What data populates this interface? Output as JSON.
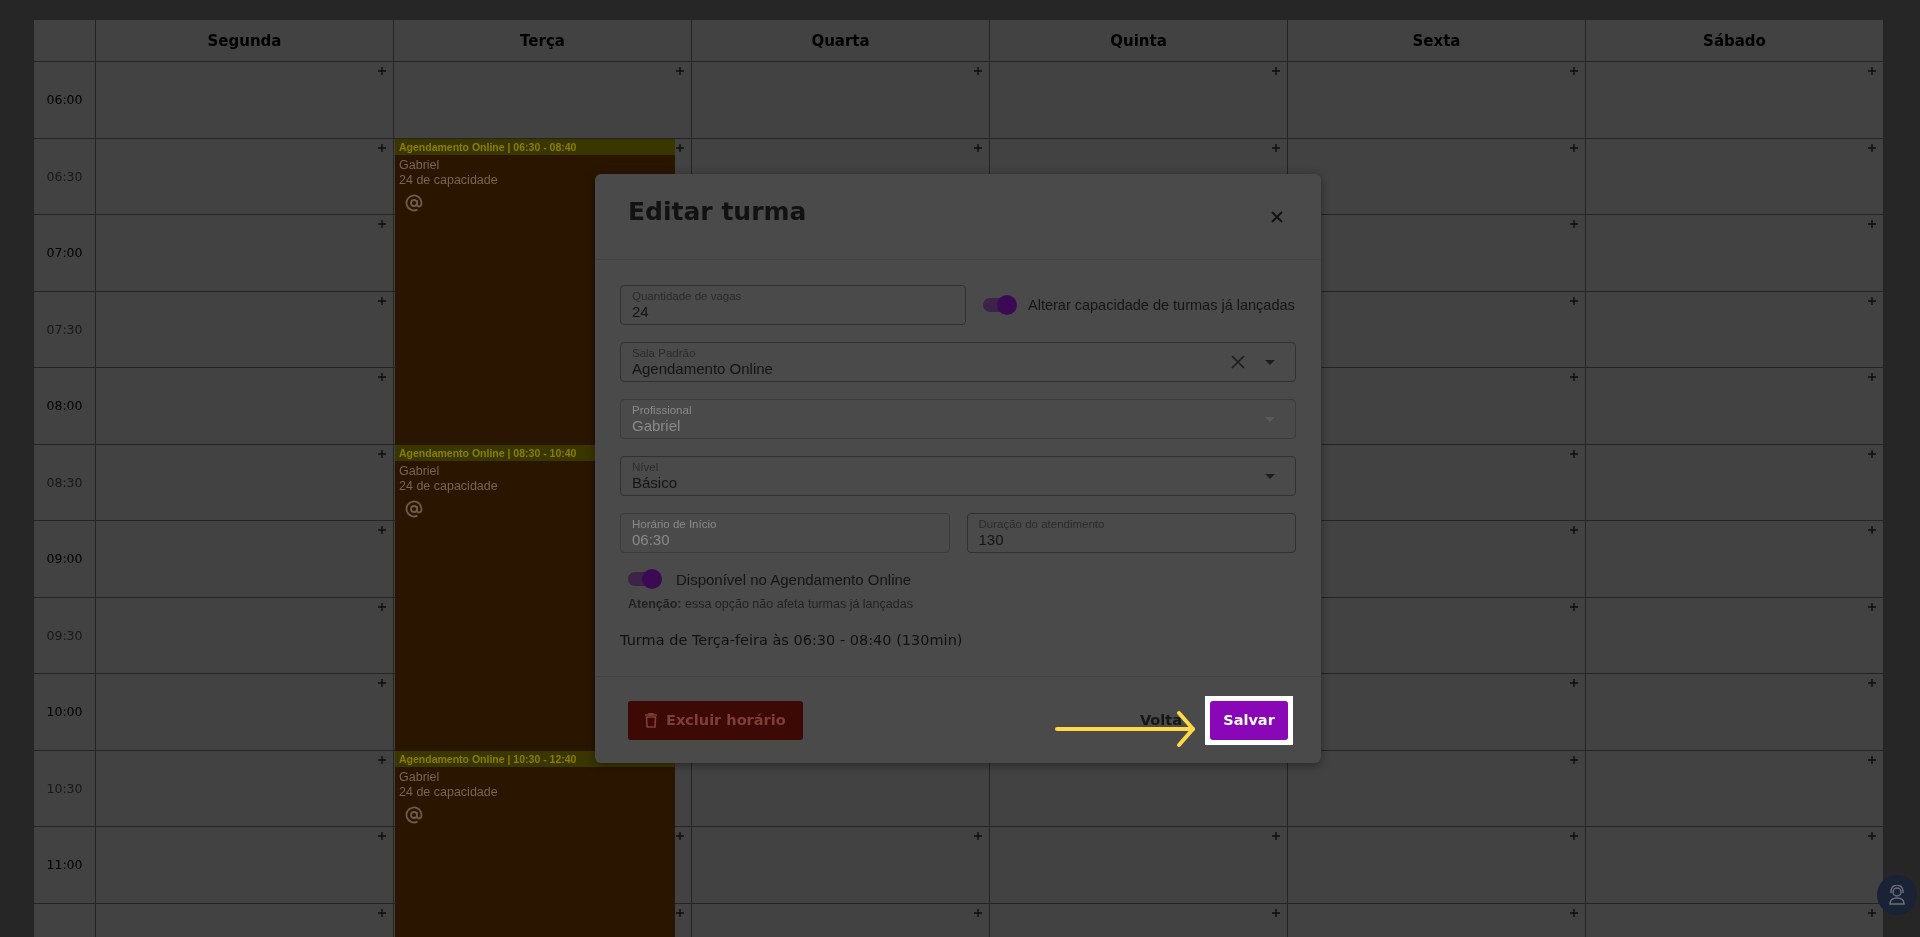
{
  "calendar": {
    "days": [
      {
        "label": "Segunda"
      },
      {
        "label": "Terça",
        "events": [
          {
            "title": "Agendamento Online | 06:30 - 08:40",
            "professional": "Gabriel",
            "capacity": "24 de capacidade",
            "online": true
          },
          {
            "title": "Agendamento Online | 08:30 - 10:40",
            "professional": "Gabriel",
            "capacity": "24 de capacidade",
            "online": true
          },
          {
            "title": "Agendamento Online | 10:30 - 12:40",
            "professional": "Gabriel",
            "capacity": "24 de capacidade",
            "online": true
          }
        ]
      },
      {
        "label": "Quarta"
      },
      {
        "label": "Quinta"
      },
      {
        "label": "Sexta"
      },
      {
        "label": "Sábado"
      }
    ],
    "times": [
      {
        "label": "06:00",
        "minor": false
      },
      {
        "label": "06:30",
        "minor": true
      },
      {
        "label": "07:00",
        "minor": false
      },
      {
        "label": "07:30",
        "minor": true
      },
      {
        "label": "08:00",
        "minor": false
      },
      {
        "label": "08:30",
        "minor": true
      },
      {
        "label": "09:00",
        "minor": false
      },
      {
        "label": "09:30",
        "minor": true
      },
      {
        "label": "10:00",
        "minor": false
      },
      {
        "label": "10:30",
        "minor": true
      },
      {
        "label": "11:00",
        "minor": false
      }
    ]
  },
  "modal": {
    "title": "Editar turma",
    "capacity_field": {
      "label": "Quantidade de vagas",
      "value": "24"
    },
    "update_launched_toggle": {
      "label": "Alterar capacidade de turmas já lançadas",
      "on": true
    },
    "selects": [
      {
        "label": "Sala Padrão",
        "value": "Agendamento Online",
        "clearable": true,
        "disabled": false
      },
      {
        "label": "Profissional",
        "value": "Gabriel",
        "clearable": false,
        "disabled": true
      },
      {
        "label": "Nível",
        "value": "Básico",
        "clearable": false,
        "disabled": false
      }
    ],
    "start_field": {
      "label": "Horário de Início",
      "value": "06:30",
      "disabled": true
    },
    "duration_field": {
      "label": "Duração do atendimento",
      "value": "130",
      "disabled": false
    },
    "online_toggle": {
      "label": "Disponível no Agendamento Online",
      "on": true
    },
    "note": "**Atenção:** essa opção não afeta turmas já lançadas",
    "summary": "Turma de Terça-feira às 06:30 - 08:40 (130min)",
    "delete_button": "Excluir horário",
    "back_button": "Volta",
    "save_button": "Salvar"
  }
}
